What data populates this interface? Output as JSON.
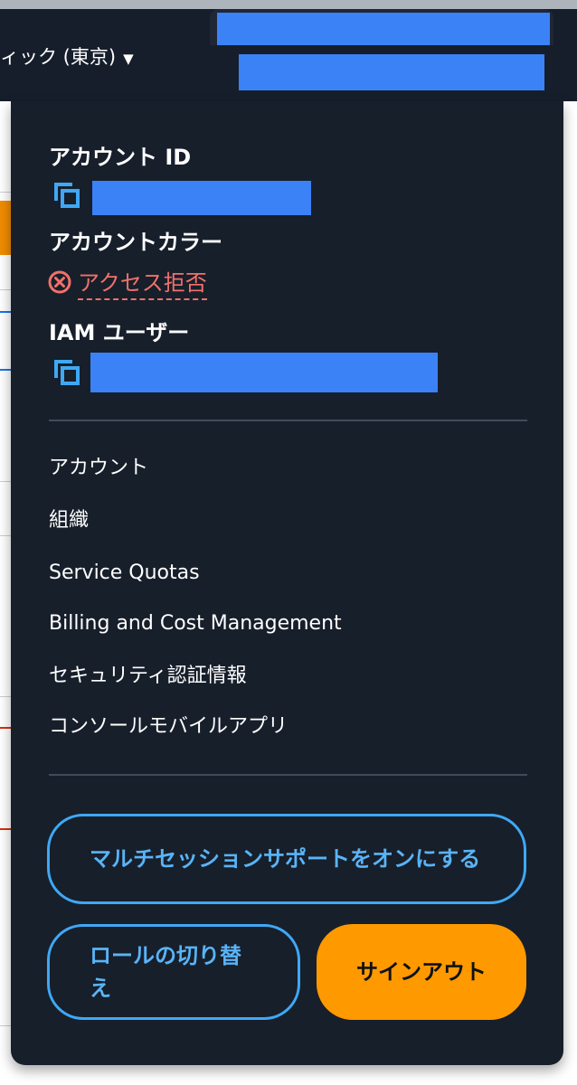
{
  "header": {
    "region_label": "ィック (東京)",
    "region_caret": "▼"
  },
  "account_menu": {
    "account_id_label": "アカウント ID",
    "account_color_label": "アカウントカラー",
    "account_color_error": "アクセス拒否",
    "iam_user_label": "IAM ユーザー",
    "items": [
      {
        "label": "アカウント"
      },
      {
        "label": "組織"
      },
      {
        "label": "Service Quotas"
      },
      {
        "label": "Billing and Cost Management"
      },
      {
        "label": "セキュリティ認証情報"
      },
      {
        "label": "コンソールモバイルアプリ"
      }
    ],
    "multi_session_button": "マルチセッションサポートをオンにする",
    "switch_role_button": "ロールの切り替え",
    "sign_out_button": "サインアウト"
  },
  "colors": {
    "panel_bg": "#171f2b",
    "accent_link": "#3fa8f5",
    "primary_button": "#ff9900",
    "error": "#f0716a",
    "redaction": "#3b82f6"
  },
  "icons": [
    "chevron-down-icon",
    "copy-icon",
    "error-circle-icon"
  ]
}
